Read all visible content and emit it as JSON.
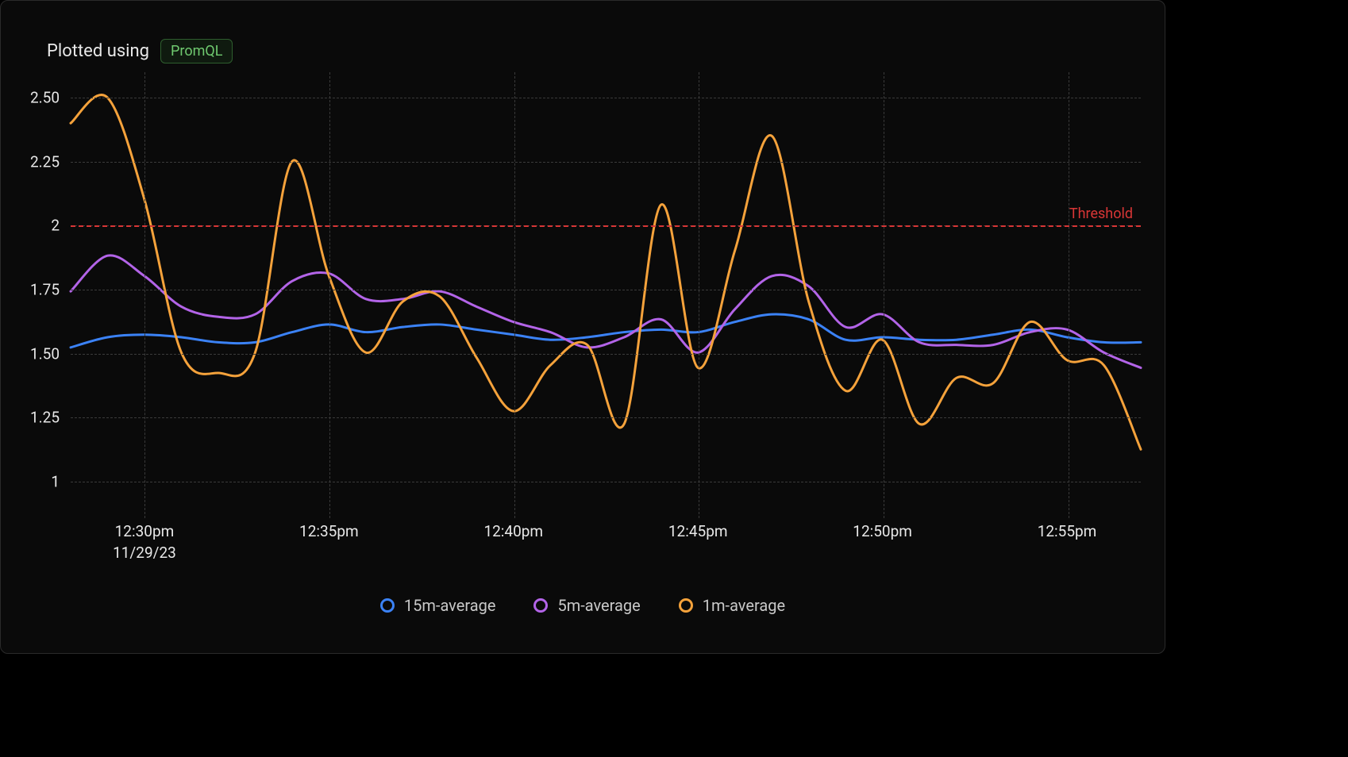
{
  "header": {
    "prefix": "Plotted using",
    "badge": "PromQL"
  },
  "chart_data": {
    "type": "line",
    "xlabel": "",
    "ylabel": "",
    "ylim": [
      1,
      2.5
    ],
    "y_ticks": [
      1,
      1.25,
      1.5,
      1.75,
      2,
      2.25,
      2.5
    ],
    "y_tick_labels": [
      "1",
      "1.25",
      "1.50",
      "1.75",
      "2",
      "2.25",
      "2.50"
    ],
    "x_ticks": [
      "12:30pm",
      "12:35pm",
      "12:40pm",
      "12:45pm",
      "12:50pm",
      "12:55pm"
    ],
    "x_date_label": "11/29/23",
    "threshold": {
      "value": 2,
      "label": "Threshold",
      "color": "#d93636"
    },
    "x": [
      0,
      1,
      2,
      3,
      4,
      5,
      6,
      7,
      8,
      9,
      10,
      11,
      12,
      13,
      14,
      15,
      16,
      17,
      18,
      19,
      20,
      21,
      22,
      23,
      24,
      25,
      26,
      27,
      28,
      29
    ],
    "series": [
      {
        "name": "15m-average",
        "color": "#3b82f6",
        "values": [
          1.52,
          1.56,
          1.57,
          1.56,
          1.54,
          1.54,
          1.58,
          1.61,
          1.58,
          1.6,
          1.61,
          1.59,
          1.57,
          1.55,
          1.56,
          1.58,
          1.59,
          1.58,
          1.62,
          1.65,
          1.63,
          1.55,
          1.56,
          1.55,
          1.55,
          1.57,
          1.59,
          1.56,
          1.54,
          1.54
        ]
      },
      {
        "name": "5m-average",
        "color": "#b364e8",
        "values": [
          1.74,
          1.88,
          1.8,
          1.68,
          1.64,
          1.65,
          1.78,
          1.81,
          1.71,
          1.71,
          1.74,
          1.68,
          1.62,
          1.58,
          1.52,
          1.56,
          1.63,
          1.5,
          1.67,
          1.8,
          1.76,
          1.6,
          1.65,
          1.54,
          1.53,
          1.53,
          1.58,
          1.59,
          1.5,
          1.44
        ]
      },
      {
        "name": "1m-average",
        "color": "#f5a23b",
        "values": [
          2.4,
          2.5,
          2.1,
          1.5,
          1.42,
          1.5,
          2.25,
          1.8,
          1.5,
          1.7,
          1.72,
          1.48,
          1.27,
          1.45,
          1.53,
          1.22,
          2.08,
          1.44,
          1.9,
          2.35,
          1.7,
          1.35,
          1.55,
          1.22,
          1.4,
          1.38,
          1.62,
          1.47,
          1.45,
          1.12
        ]
      }
    ]
  },
  "legend_items": [
    {
      "label": "15m-average",
      "color": "#3b82f6"
    },
    {
      "label": "5m-average",
      "color": "#b364e8"
    },
    {
      "label": "1m-average",
      "color": "#f5a23b"
    }
  ]
}
